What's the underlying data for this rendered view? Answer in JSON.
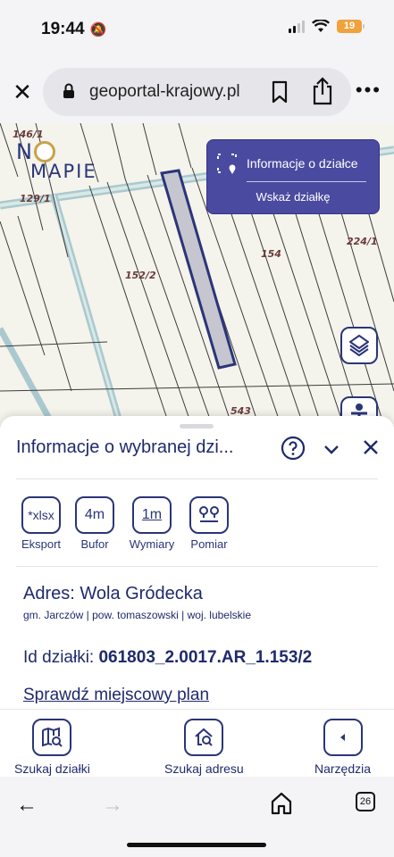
{
  "status": {
    "time": "19:44",
    "battery": "19"
  },
  "browser": {
    "url": "geoportal-krajowy.pl"
  },
  "map": {
    "logo_n": "N",
    "logo_mapie": "MAPIE",
    "labels": {
      "l146": "146/1",
      "l129": "129/1",
      "l1522": "152/2",
      "l154": "154",
      "l2241": "224/1",
      "l543": "543"
    },
    "info_button": "Informacje o działce",
    "point_button": "Wskaż działkę"
  },
  "sheet": {
    "title": "Informacje o wybranej dzi...",
    "tools": [
      {
        "icon_text": "*xlsx",
        "label": "Eksport"
      },
      {
        "icon_text": "4m",
        "label": "Bufor"
      },
      {
        "icon_text": "1m",
        "label": "Wymiary"
      },
      {
        "icon_text": "",
        "label": "Pomiar"
      }
    ],
    "address": "Adres: Wola Gródecka",
    "address_sub": "gm. Jarczów | pow. tomaszowski | woj. lubelskie",
    "id_label": "Id działki:",
    "id_value": "061803_2.0017.AR_1.153/2",
    "plan_link": "Sprawdź miejscowy plan"
  },
  "bottom_nav": {
    "search_plot": "Szukaj działki",
    "search_address": "Szukaj adresu",
    "tools": "Narzędzia"
  },
  "safari": {
    "tab_count": "26"
  },
  "colors": {
    "navy": "#2b3578",
    "panel": "#4a4aa0",
    "parcel_fill": "#c6c6d0"
  }
}
